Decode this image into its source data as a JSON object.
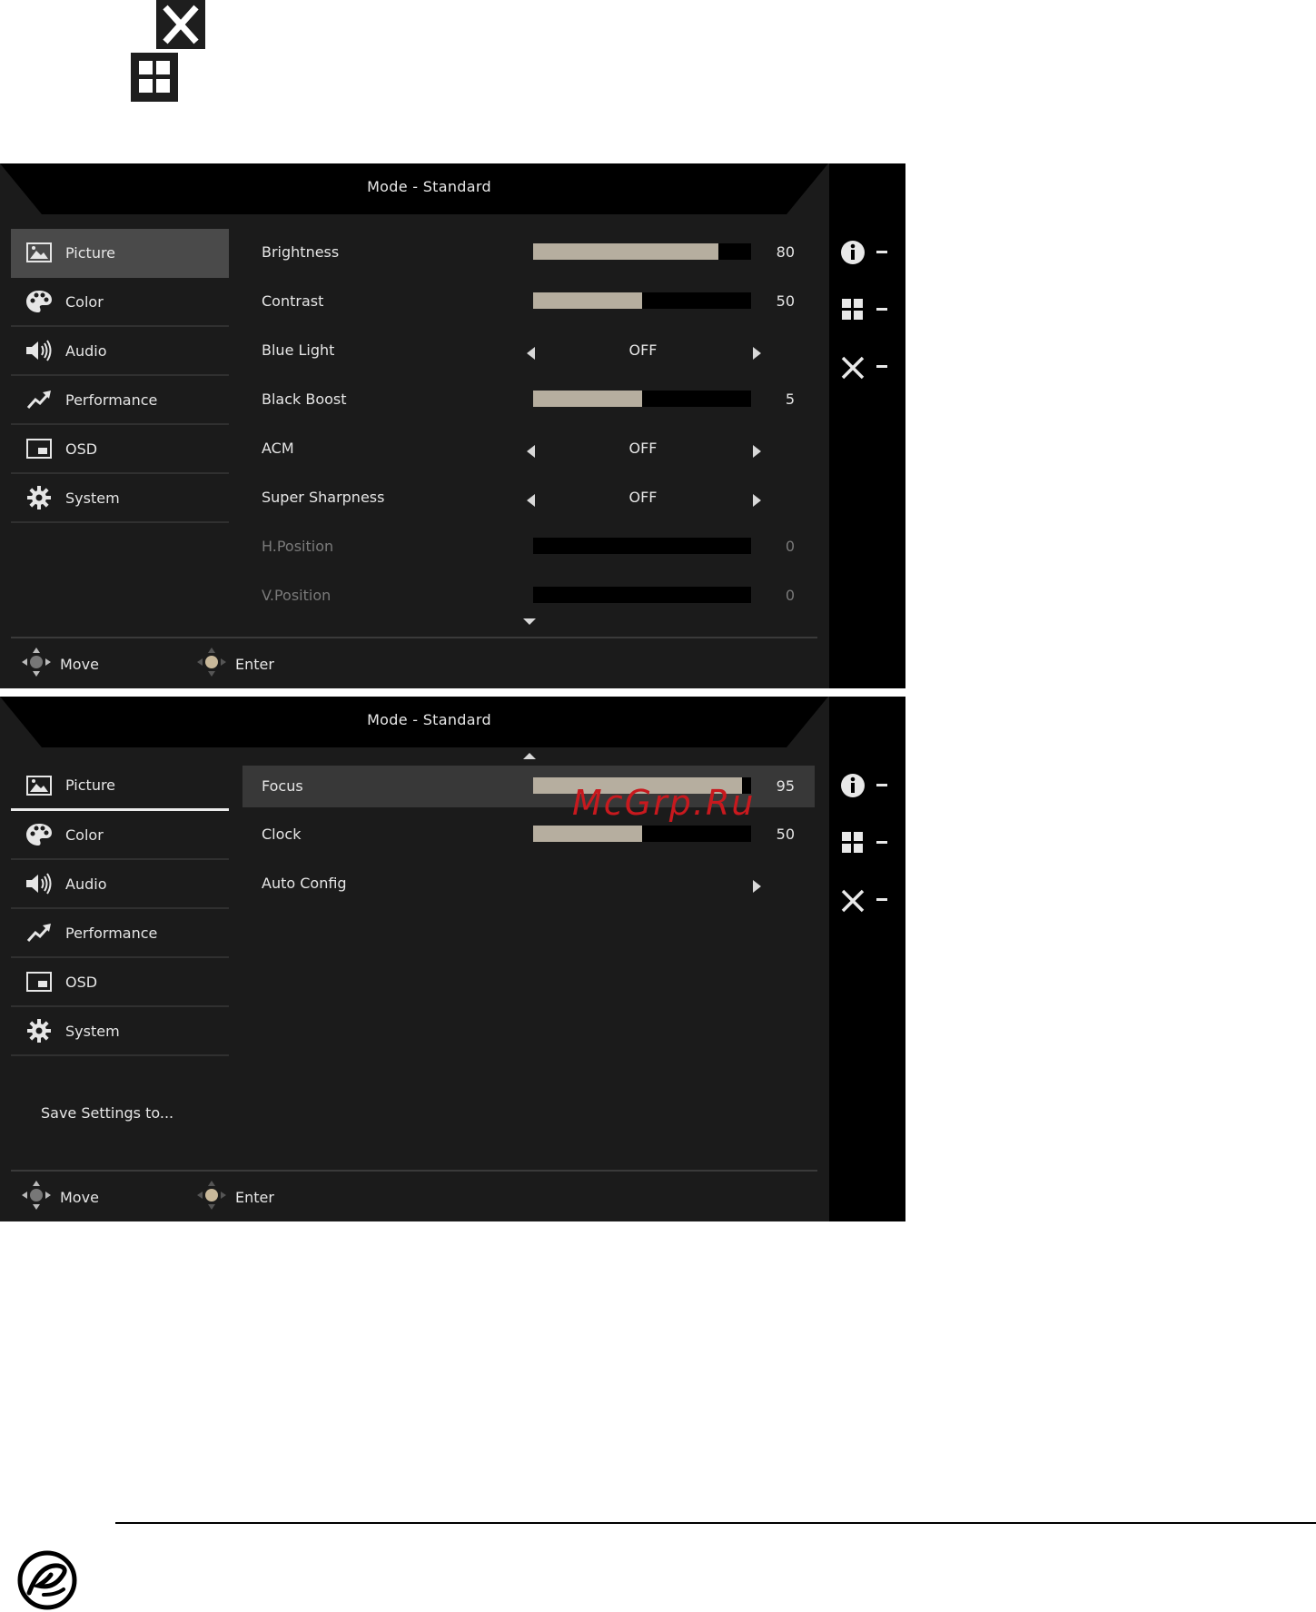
{
  "top_icons": {
    "close": "close-icon",
    "grid": "grid-icon"
  },
  "osd1": {
    "title": "Mode - Standard",
    "menu": [
      "Picture",
      "Color",
      "Audio",
      "Performance",
      "OSD",
      "System"
    ],
    "rows": [
      {
        "label": "Brightness",
        "kind": "bar",
        "value": "80",
        "fill": 0.85
      },
      {
        "label": "Contrast",
        "kind": "bar",
        "value": "50",
        "fill": 0.5
      },
      {
        "label": "Blue Light",
        "kind": "option",
        "value": "OFF"
      },
      {
        "label": "Black Boost",
        "kind": "bar",
        "value": "5",
        "fill": 0.5
      },
      {
        "label": "ACM",
        "kind": "option",
        "value": "OFF"
      },
      {
        "label": "Super Sharpness",
        "kind": "option",
        "value": "OFF"
      },
      {
        "label": "H.Position",
        "kind": "bar",
        "value": "0",
        "fill": 0
      },
      {
        "label": "V.Position",
        "kind": "bar",
        "value": "0",
        "fill": 0
      }
    ],
    "footer": {
      "move": "Move",
      "enter": "Enter"
    }
  },
  "osd2": {
    "title": "Mode - Standard",
    "menu": [
      "Picture",
      "Color",
      "Audio",
      "Performance",
      "OSD",
      "System"
    ],
    "save": "Save Settings to...",
    "rows": [
      {
        "label": "Focus",
        "kind": "bar",
        "value": "95",
        "fill": 0.96
      },
      {
        "label": "Clock",
        "kind": "bar",
        "value": "50",
        "fill": 0.5
      },
      {
        "label": "Auto Config",
        "kind": "submenu"
      }
    ],
    "footer": {
      "move": "Move",
      "enter": "Enter"
    }
  },
  "side_icons": [
    "info-icon",
    "grid-icon",
    "close-icon"
  ],
  "watermark": "McGrp.Ru",
  "colors": {
    "panel": "#1b1b1b",
    "side": "#000000",
    "bar_fill": "#b6ae9f",
    "active": "#4a4a4a",
    "watermark": "#c8191e"
  }
}
